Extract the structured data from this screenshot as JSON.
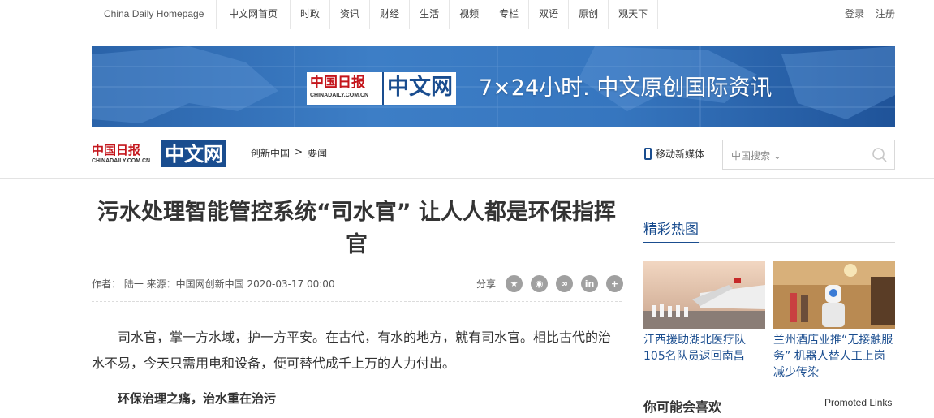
{
  "topnav": {
    "home": "China Daily Homepage",
    "links": [
      "中文网首页",
      "时政",
      "资讯",
      "财经",
      "生活",
      "视频",
      "专栏",
      "双语",
      "原创",
      "观天下"
    ],
    "login": "登录",
    "register": "注册"
  },
  "banner": {
    "logo_cn": "中国日报",
    "logo_url": "CHINADAILY.COM.CN",
    "logo_zw": "中文网",
    "slogan": "7×24小时. 中文原创国际资讯"
  },
  "header": {
    "logo_cn": "中国日报",
    "logo_url": "CHINADAILY.COM.CN",
    "logo_zw": "中文网",
    "breadcrumb": [
      "创新中国",
      ">",
      "要闻"
    ],
    "mobile_label": "移动新媒体",
    "search_select": "中国搜索",
    "search_placeholder": ""
  },
  "article": {
    "title": "污水处理智能管控系统“司水官” 让人人都是环保指挥官",
    "meta": "作者： 陆一 来源：中国网创新中国 2020-03-17 00:00",
    "share_label": "分享",
    "share_icons": [
      "qzone-icon",
      "weibo-icon",
      "wechat-icon",
      "linkedin-icon",
      "more-icon"
    ],
    "paragraph": "司水官，掌一方水域，护一方平安。在古代，有水的地方，就有司水官。相比古代的治水不易，今天只需用电和设备，便可替代成千上万的人力付出。",
    "subhead": "环保治理之痛，治水重在治污"
  },
  "sidebar": {
    "title": "精彩热图",
    "cards": [
      {
        "caption": "江西援助湖北医疗队105名队员返回南昌"
      },
      {
        "caption": "兰州酒店业推“无接触服务” 机器人替人工上岗减少传染"
      }
    ],
    "like_title": "你可能会喜欢",
    "promoted": "Promoted Links"
  },
  "colors": {
    "brand_blue": "#1a4d8f",
    "brand_red": "#c4161c",
    "banner_blue": "#3676bf"
  }
}
